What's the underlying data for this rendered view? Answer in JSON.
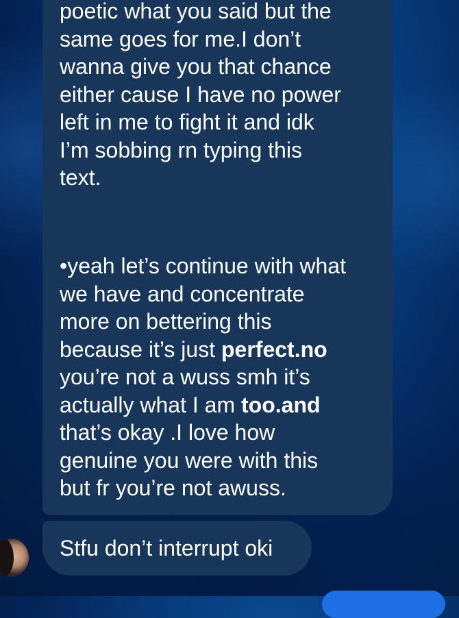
{
  "conversation": {
    "messages": [
      {
        "sender": "them",
        "paragraphs": [
          "poetic what you said but the\nsame goes for me.I don’t\nwanna give you that chance\neither cause I have no power\nleft in me to fight it and idk\nI’m sobbing rn typing this\ntext."
        ],
        "second_paragraph": {
          "part1": "•yeah let’s continue with what\nwe have and concentrate\nmore on bettering this\nbecause it’s just ",
          "bold1": "perfect.no",
          "part2": "\nyou’re not a wuss smh it’s\nactually what I am ",
          "bold2": "too.and",
          "part3": "\nthat’s okay .I love how\ngenuine you were with this\nbut fr you’re not awuss."
        }
      },
      {
        "sender": "them",
        "text": "Stfu don’t interrupt oki"
      }
    ]
  },
  "colors": {
    "bubble_received": "#173659",
    "bubble_sent": "#1e6fe6",
    "text": "#ffffff"
  }
}
